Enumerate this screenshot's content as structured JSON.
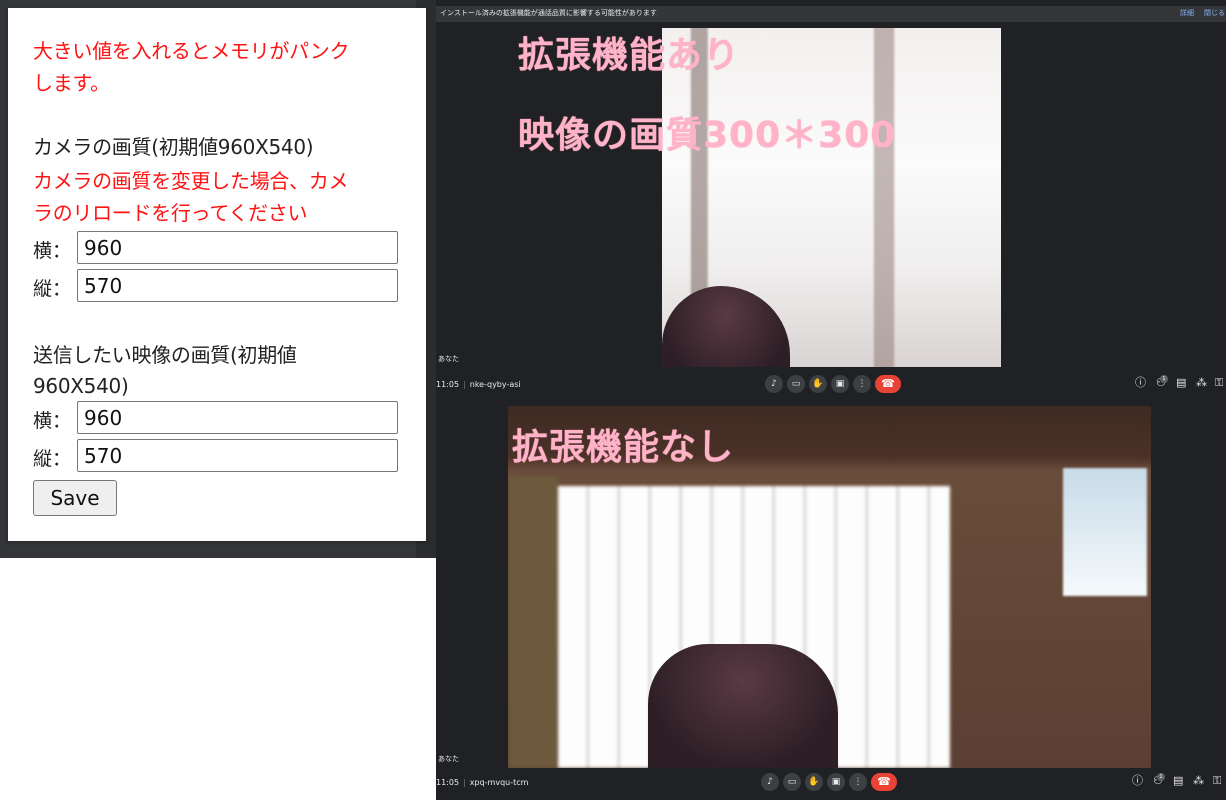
{
  "popup": {
    "warning_line1": "大きい値を入れるとメモリがパンク",
    "warning_line2": "します。",
    "camera_quality_label": "カメラの画質(初期値960X540)",
    "camera_note_line1": "カメラの画質を変更した場合、カメ",
    "camera_note_line2": "ラのリロードを行ってください",
    "camera_width_label": "横：",
    "camera_width_value": "960",
    "camera_height_label": "縦：",
    "camera_height_value": "570",
    "send_quality_line1": "送信したい映像の画質(初期値",
    "send_quality_line2": "960X540)",
    "send_width_label": "横：",
    "send_width_value": "960",
    "send_height_label": "縦：",
    "send_height_value": "570",
    "save_label": "Save"
  },
  "top_meet": {
    "banner_text": "インストール済みの拡張機能が通話品質に影響する可能性があります",
    "banner_details": "詳細",
    "banner_close": "閉じる",
    "overlay_line1": "拡張機能あり",
    "overlay_line2": "映像の画質300＊300",
    "participant_label": "あなた",
    "time": "11:05",
    "meeting_code": "nke-qyby-asi",
    "people_count": "1"
  },
  "bottom_meet": {
    "overlay_line1": "拡張機能なし",
    "participant_label": "あなた",
    "time": "11:05",
    "meeting_code": "xpq-mvqu-tcm",
    "people_count": "1"
  },
  "colors": {
    "warning_red": "#ff1414",
    "overlay_pink": "#ffb3c8",
    "end_call_red": "#ea4335",
    "meet_bg": "#202124"
  },
  "icons": [
    "mic-icon",
    "camera-icon",
    "raise-hand-icon",
    "present-icon",
    "more-icon",
    "end-call-icon",
    "info-icon",
    "people-icon",
    "chat-icon",
    "activities-icon",
    "host-controls-icon"
  ]
}
